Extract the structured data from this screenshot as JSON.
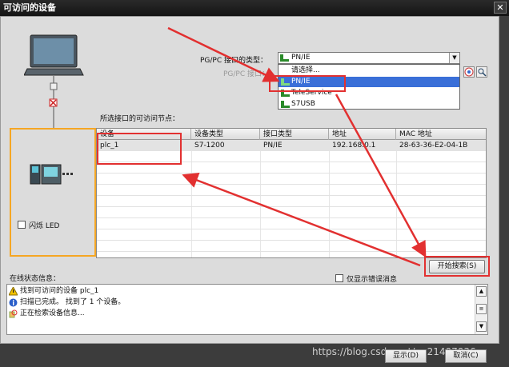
{
  "window": {
    "title": "可访问的设备"
  },
  "pgpc": {
    "type_label": "PG/PC 接口的类型：",
    "interface_label": "PG/PC 接口：",
    "type_value": "PN/IE",
    "dropdown": [
      "请选择...",
      "PN/IE",
      "TeleService",
      "S7USB"
    ]
  },
  "nodes_label": "所选接口的可访问节点：",
  "table": {
    "headers": [
      "设备",
      "设备类型",
      "接口类型",
      "地址",
      "MAC 地址"
    ],
    "rows": [
      [
        "plc_1",
        "S7-1200",
        "PN/IE",
        "192.168.0.1",
        "28-63-36-E2-04-1B"
      ]
    ]
  },
  "flash_led_label": "闪烁 LED",
  "start_search_label": "开始搜索(S)",
  "online_status_label": "在线状态信息：",
  "only_errors_label": "仅显示错误消息",
  "status_messages": [
    {
      "icon": "warning-icon",
      "text": "找到可访问的设备 plc_1"
    },
    {
      "icon": "info-icon",
      "text": "扫描已完成。 找到了 1 个设备。"
    },
    {
      "icon": "search-progress-icon",
      "text": "正在检索设备信息..."
    }
  ],
  "footer": {
    "display_label": "显示(D)",
    "cancel_label": "取消(C)"
  },
  "watermark": "https://blog.csdn.net/qq21407036",
  "colors": {
    "annotation_red": "#e23030",
    "highlight_orange": "#f5a623",
    "selection_blue": "#3a6fd8"
  }
}
